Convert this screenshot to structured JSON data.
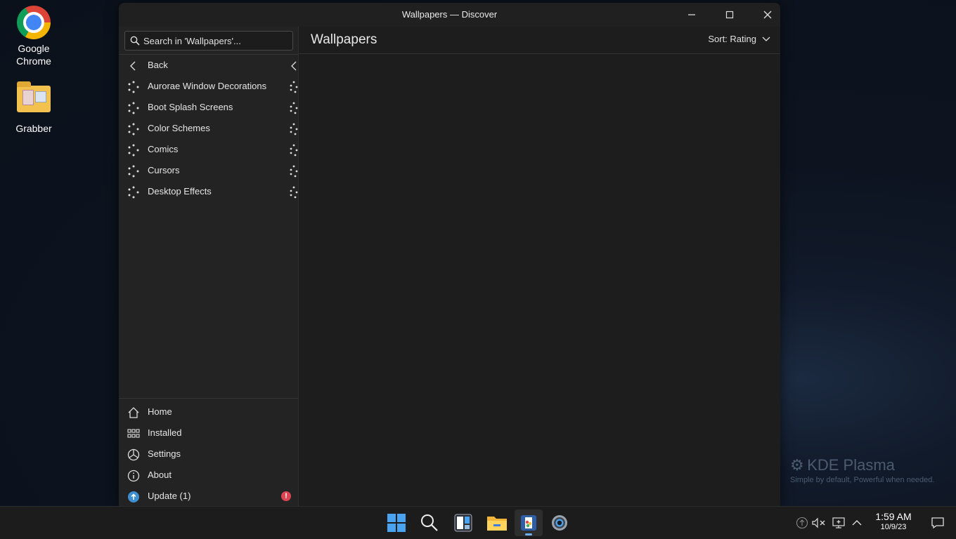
{
  "desktop": {
    "icons": [
      {
        "label": "Google\nChrome"
      },
      {
        "label": "Grabber"
      }
    ]
  },
  "window": {
    "title": "Wallpapers — Discover",
    "search": {
      "placeholder": "Search in 'Wallpapers'..."
    },
    "sidebar": {
      "back_label": "Back",
      "categories": [
        {
          "label": "Aurorae Window Decorations"
        },
        {
          "label": "Boot Splash Screens"
        },
        {
          "label": "Color Schemes"
        },
        {
          "label": "Comics"
        },
        {
          "label": "Cursors"
        },
        {
          "label": "Desktop Effects"
        }
      ],
      "bottom": [
        {
          "label": "Home",
          "icon": "home-icon"
        },
        {
          "label": "Installed",
          "icon": "grid-icon"
        },
        {
          "label": "Settings",
          "icon": "settings-icon"
        },
        {
          "label": "About",
          "icon": "info-icon"
        },
        {
          "label": "Update (1)",
          "icon": "update-icon",
          "badge": "!"
        }
      ]
    },
    "main": {
      "heading": "Wallpapers",
      "sort_label": "Sort: Rating"
    }
  },
  "watermark": {
    "brand": "KDE Plasma",
    "tagline": "Simple by default, Powerful when  needed."
  },
  "taskbar": {
    "apps": [
      "start-icon",
      "search-icon",
      "widgets-icon",
      "file-explorer-icon",
      "discover-icon",
      "settings-icon"
    ],
    "clock": {
      "time": "1:59 AM",
      "date": "10/9/23"
    }
  },
  "colors": {
    "accent": "#6ab0f3",
    "badge": "#da4453",
    "window_bg": "#1f1f1f"
  }
}
